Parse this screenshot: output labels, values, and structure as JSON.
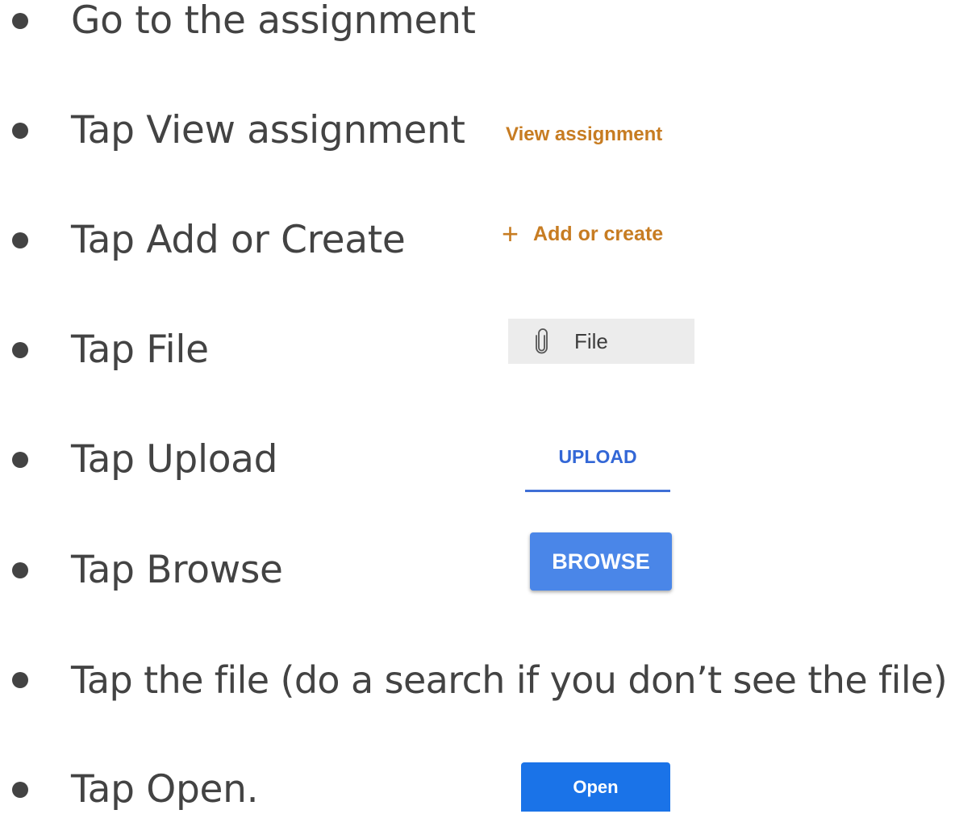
{
  "steps": [
    "Go to the assignment",
    "Tap View assignment",
    "Tap Add or Create",
    "Tap File",
    "Tap Upload",
    "Tap Browse",
    "Tap the file (do a search if you don’t see the file)",
    "Tap Open."
  ],
  "ui_samples": {
    "view_assignment": "View assignment",
    "add_or_create": "Add or create",
    "file": "File",
    "upload": "UPLOAD",
    "browse": "BROWSE",
    "open": "Open"
  },
  "icons": {
    "plus": "plus-icon",
    "file": "paperclip-icon"
  },
  "colors": {
    "text": "#434343",
    "accent_orange": "#c77c22",
    "upload_blue": "#3367d6",
    "browse_blue": "#4a86e8",
    "open_blue": "#1a73e8"
  }
}
